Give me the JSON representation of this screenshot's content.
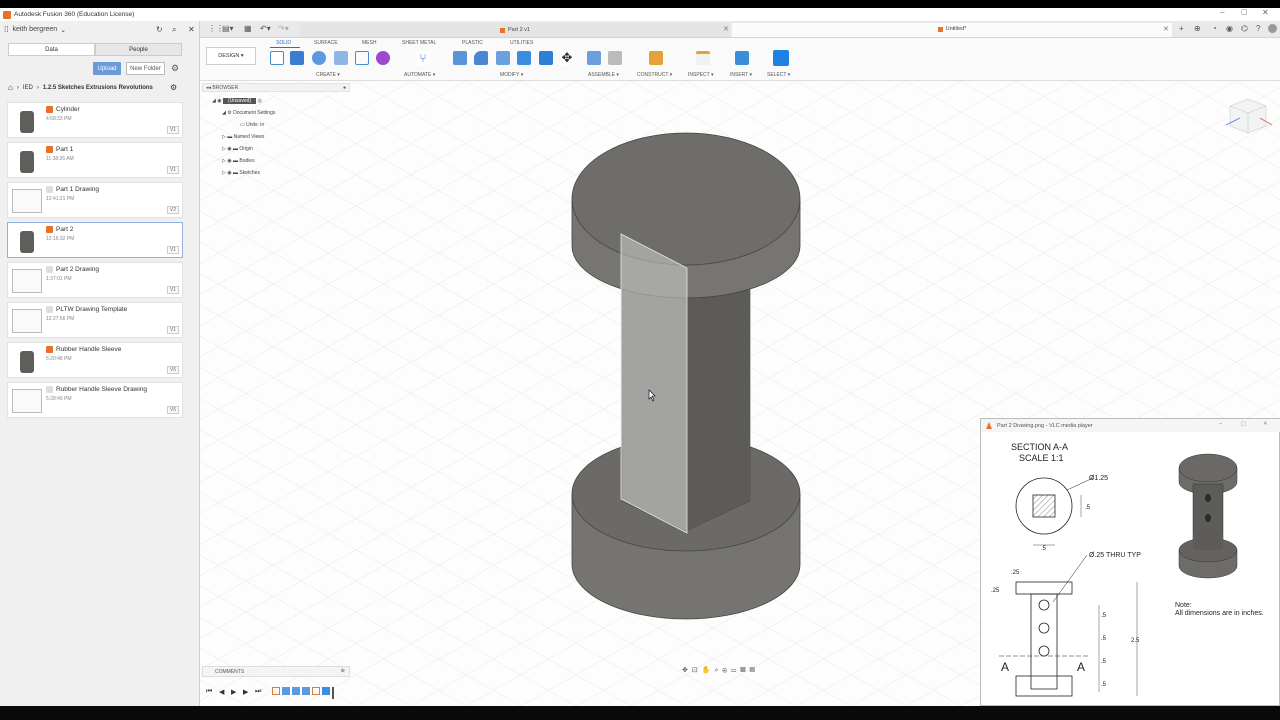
{
  "app": {
    "title": "Autodesk Fusion 360 (Education License)",
    "user": "keith bergreen",
    "tabs": [
      "Data",
      "People"
    ],
    "upload_label": "Upload",
    "new_folder_label": "New Folder",
    "breadcrumb": [
      "IED",
      "1.2.5 Sketches Extrusions Revolutions"
    ]
  },
  "files": [
    {
      "name": "Cylinder",
      "time": "4:58:33 PM",
      "version": "V1",
      "type": "model"
    },
    {
      "name": "Part 1",
      "time": "11:38:26 AM",
      "version": "V1",
      "type": "model"
    },
    {
      "name": "Part 1 Drawing",
      "time": "12:41:21 PM",
      "version": "V2",
      "type": "drawing"
    },
    {
      "name": "Part 2",
      "time": "12:16:32 PM",
      "version": "V1",
      "type": "model",
      "selected": true
    },
    {
      "name": "Part 2 Drawing",
      "time": "1:37:01 PM",
      "version": "V1",
      "type": "drawing"
    },
    {
      "name": "PLTW Drawing Template",
      "time": "12:27:56 PM",
      "version": "V1",
      "type": "drawing"
    },
    {
      "name": "Rubber Handle Sleeve",
      "time": "5:20:48 PM",
      "version": "V6",
      "type": "model"
    },
    {
      "name": "Rubber Handle Sleeve Drawing",
      "time": "5:28:49 PM",
      "version": "V6",
      "type": "drawing"
    }
  ],
  "doc_tabs": [
    {
      "label": "Part 2 v1"
    },
    {
      "label": "Untitled*"
    }
  ],
  "toolbar": {
    "workspace": "DESIGN ▾",
    "tabs": [
      "SOLID",
      "SURFACE",
      "MESH",
      "SHEET METAL",
      "PLASTIC",
      "UTILITIES"
    ],
    "groups": [
      "CREATE ▾",
      "AUTOMATE ▾",
      "MODIFY ▾",
      "ASSEMBLE ▾",
      "CONSTRUCT ▾",
      "INSPECT ▾",
      "INSERT ▾",
      "SELECT ▾"
    ]
  },
  "browser": {
    "header": "BROWSER",
    "root": "(Unsaved)",
    "document_settings": "Document Settings",
    "units": "Units: in",
    "items": [
      "Named Views",
      "Origin",
      "Bodies",
      "Sketches"
    ]
  },
  "comments_label": "COMMENTS",
  "vlc": {
    "title": "Part 2 Drawing.png - VLC media player",
    "section_title": "SECTION A-A",
    "scale": "SCALE 1:1",
    "dia_label": "Ø1.25",
    "sq_label_h": ".5",
    "sq_label_w": ".5",
    "thru_label": "Ø.25 THRU TYP",
    "dim_25_top": ".25",
    "dim_25_left": ".25",
    "dim_5": ".5",
    "dim_2_5": "2.5",
    "section_a": "A",
    "note_title": "Note:",
    "note_text": "All dimensions are in inches."
  },
  "colors": {
    "accent": "#2a6fc7",
    "model_fill": "#787670",
    "model_top": "#6e6d69",
    "fusion_orange": "#e8712b"
  }
}
